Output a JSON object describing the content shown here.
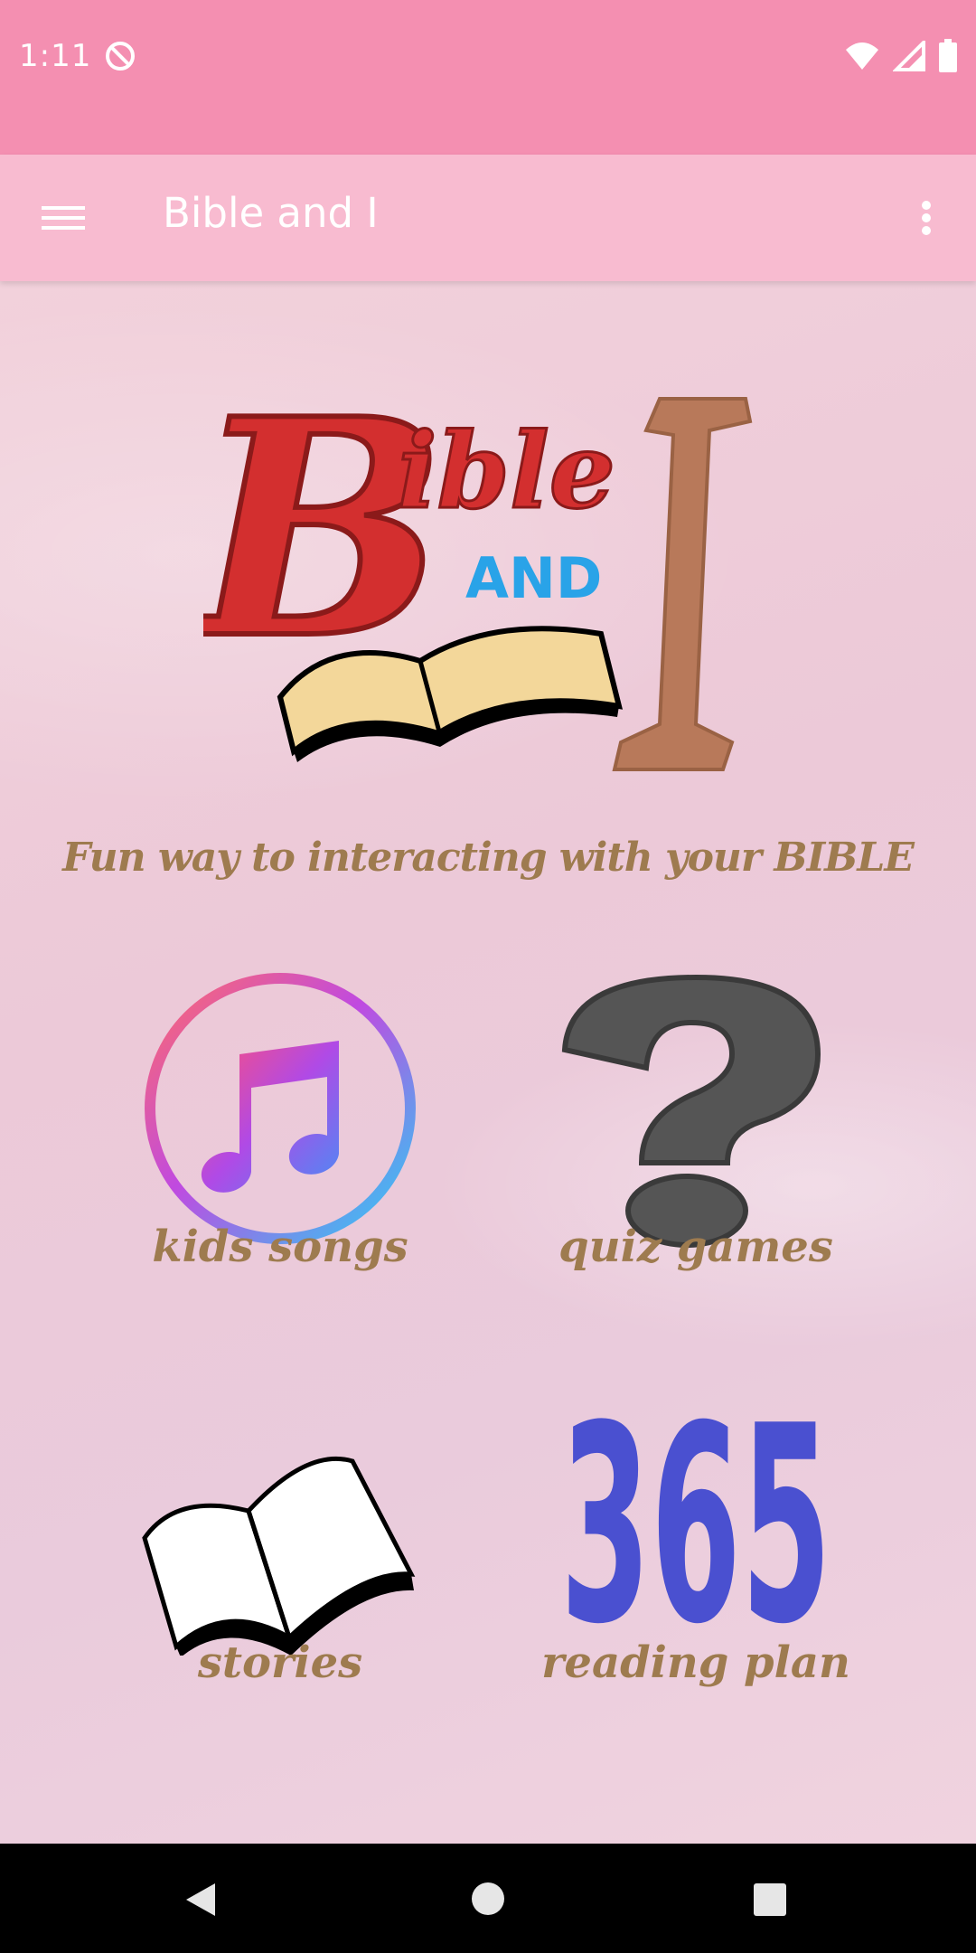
{
  "status_bar": {
    "time": "1:11"
  },
  "app_bar": {
    "title": "Bible and I"
  },
  "logo": {
    "word_bible": "ible",
    "word_b": "B",
    "word_and": "AND",
    "word_i": "I"
  },
  "tagline": "Fun way to interacting with your BIBLE",
  "tiles": [
    {
      "label": "kids songs",
      "icon": "music-note-icon"
    },
    {
      "label": "quiz games",
      "icon": "question-mark-icon"
    },
    {
      "label": "stories",
      "icon": "open-book-icon"
    },
    {
      "label": "reading plan",
      "icon": "calendar-365-icon",
      "art_text": "365"
    }
  ],
  "colors": {
    "status_bar": "#f48fb1",
    "app_bar": "#f8bbd0",
    "label": "#9e7b4f",
    "logo_red": "#d32f2f",
    "logo_blue": "#29a3e8",
    "logo_brown": "#b8795a",
    "reading_plan_blue": "#4a50d0"
  }
}
